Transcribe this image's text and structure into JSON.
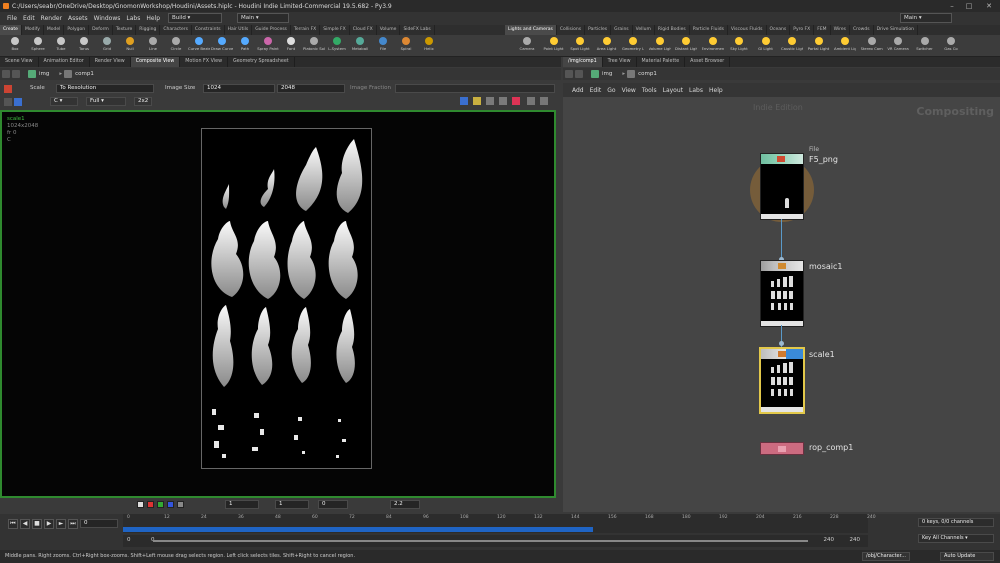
{
  "window": {
    "title": "C:/Users/seabr/OneDrive/Desktop/GnomonWorkshop/Houdini/Assets.hiplc - Houdini Indie Limited-Commercial 19.5.682 - Py3.9"
  },
  "menu": {
    "items": [
      "File",
      "Edit",
      "Render",
      "Assets",
      "Windows",
      "Labs",
      "Help"
    ],
    "build": "Build",
    "desktop": "Main",
    "right_desktop": "Main"
  },
  "shelf_tabs_left": [
    "Create",
    "Modify",
    "Model",
    "Polygon",
    "Deform",
    "Texture",
    "Rigging",
    "Characters",
    "Constraints",
    "Hair Utils",
    "Guide Process",
    "Terrain FX",
    "Simple FX",
    "Cloud FX",
    "Volume",
    "SideFX Labs"
  ],
  "shelf_tabs_right": [
    "Lights and Cameras",
    "Collisions",
    "Particles",
    "Grains",
    "Vellum",
    "Rigid Bodies",
    "Particle Fluids",
    "Viscous Fluids",
    "Oceans",
    "Pyro FX",
    "FEM",
    "Wires",
    "Crowds",
    "Drive Simulation"
  ],
  "shelf_tools_left": [
    {
      "label": "Box",
      "color": "#c8c8c8"
    },
    {
      "label": "Sphere",
      "color": "#c8c8c8"
    },
    {
      "label": "Tube",
      "color": "#c8c8c8"
    },
    {
      "label": "Torus",
      "color": "#c8c8c8"
    },
    {
      "label": "Grid",
      "color": "#9aa"
    },
    {
      "label": "Null",
      "color": "#e0a020"
    },
    {
      "label": "Line",
      "color": "#aaa"
    },
    {
      "label": "Circle",
      "color": "#aaa"
    },
    {
      "label": "Curve Bezier",
      "color": "#5af"
    },
    {
      "label": "Draw Curve",
      "color": "#5af"
    },
    {
      "label": "Path",
      "color": "#5af"
    },
    {
      "label": "Spray Paint",
      "color": "#c6a"
    },
    {
      "label": "Font",
      "color": "#ddd"
    },
    {
      "label": "Platonic Solids",
      "color": "#aaa"
    },
    {
      "label": "L-System",
      "color": "#3a6"
    },
    {
      "label": "Metaball",
      "color": "#5a9"
    },
    {
      "label": "File",
      "color": "#48c"
    },
    {
      "label": "Spiral",
      "color": "#d83"
    },
    {
      "label": "Helix",
      "color": "#c90"
    }
  ],
  "shelf_tools_right": [
    {
      "label": "Camera",
      "color": "#aaa"
    },
    {
      "label": "Point Light",
      "color": "#fc3"
    },
    {
      "label": "Spot Light",
      "color": "#fc3"
    },
    {
      "label": "Area Light",
      "color": "#fc3"
    },
    {
      "label": "Geometry Light",
      "color": "#fc3"
    },
    {
      "label": "Volume Light",
      "color": "#fc3"
    },
    {
      "label": "Distant Light",
      "color": "#fc3"
    },
    {
      "label": "Environment Light",
      "color": "#fc3"
    },
    {
      "label": "Sky Light",
      "color": "#fc3"
    },
    {
      "label": "GI Light",
      "color": "#fc3"
    },
    {
      "label": "Caustic Light",
      "color": "#fc3"
    },
    {
      "label": "Portal Light",
      "color": "#fc3"
    },
    {
      "label": "Ambient Light",
      "color": "#fc3"
    },
    {
      "label": "Stereo Camera",
      "color": "#aaa"
    },
    {
      "label": "VR Camera",
      "color": "#aaa"
    },
    {
      "label": "Switcher",
      "color": "#aaa"
    },
    {
      "label": "Gas Co",
      "color": "#aaa"
    }
  ],
  "left_tabs": [
    "Scene View",
    "Animation Editor",
    "Render View",
    "Composite View",
    "Motion FX View",
    "Geometry Spreadsheet"
  ],
  "right_tabs": [
    "/img/comp1",
    "Tree View",
    "Material Palette",
    "Asset Browser"
  ],
  "left_path": {
    "net": "img",
    "node": "comp1"
  },
  "right_path": {
    "net": "img",
    "node": "comp1"
  },
  "viewer": {
    "scale_label": "Scale",
    "scale_mode": "To Resolution",
    "image_size_label": "Image Size",
    "width": "1024",
    "height": "2048",
    "image_fraction": "Image Fraction",
    "channel": "C",
    "range": "Full",
    "zoom_mode": "2x2",
    "info_node": "scale1",
    "info_res": "1024x2048",
    "info_frame": "fr 0",
    "info_plane": "C"
  },
  "viewer_bottom": {
    "frame_a": "1",
    "frame_b": "1",
    "value": "0",
    "gamma": "2.2"
  },
  "network": {
    "menu": [
      "Add",
      "Edit",
      "Go",
      "View",
      "Tools",
      "Layout",
      "Labs",
      "Help"
    ],
    "watermark": "Indie Edition",
    "context": "Compositing",
    "nodes": [
      {
        "name": "F5_png",
        "type": "File",
        "accent": "#6fbfa0"
      },
      {
        "name": "mosaic1",
        "type": "",
        "accent": "#d8d8d8"
      },
      {
        "name": "scale1",
        "type": "",
        "accent": "#3a8ad8"
      },
      {
        "name": "rop_comp1",
        "type": "",
        "accent": "#cc6b80"
      }
    ]
  },
  "timeline": {
    "current_frame": "0",
    "ticks": [
      "0",
      "12",
      "24",
      "36",
      "48",
      "60",
      "72",
      "84",
      "96",
      "108",
      "120",
      "132",
      "144",
      "156",
      "168",
      "180",
      "192",
      "204",
      "216",
      "228",
      "240"
    ],
    "start": "0",
    "start2": "0",
    "end": "240",
    "end2": "240",
    "keys": "0 keys, 0/0 channels",
    "key_all": "Key All Channels"
  },
  "status": {
    "text": "Middle pans. Right zooms. Ctrl+Right box-zooms.   Shift+Left mouse drag selects region. Left click selects tiles. Shift+Right to cancel region.",
    "obj": "/obj/Character...",
    "update": "Auto Update"
  }
}
